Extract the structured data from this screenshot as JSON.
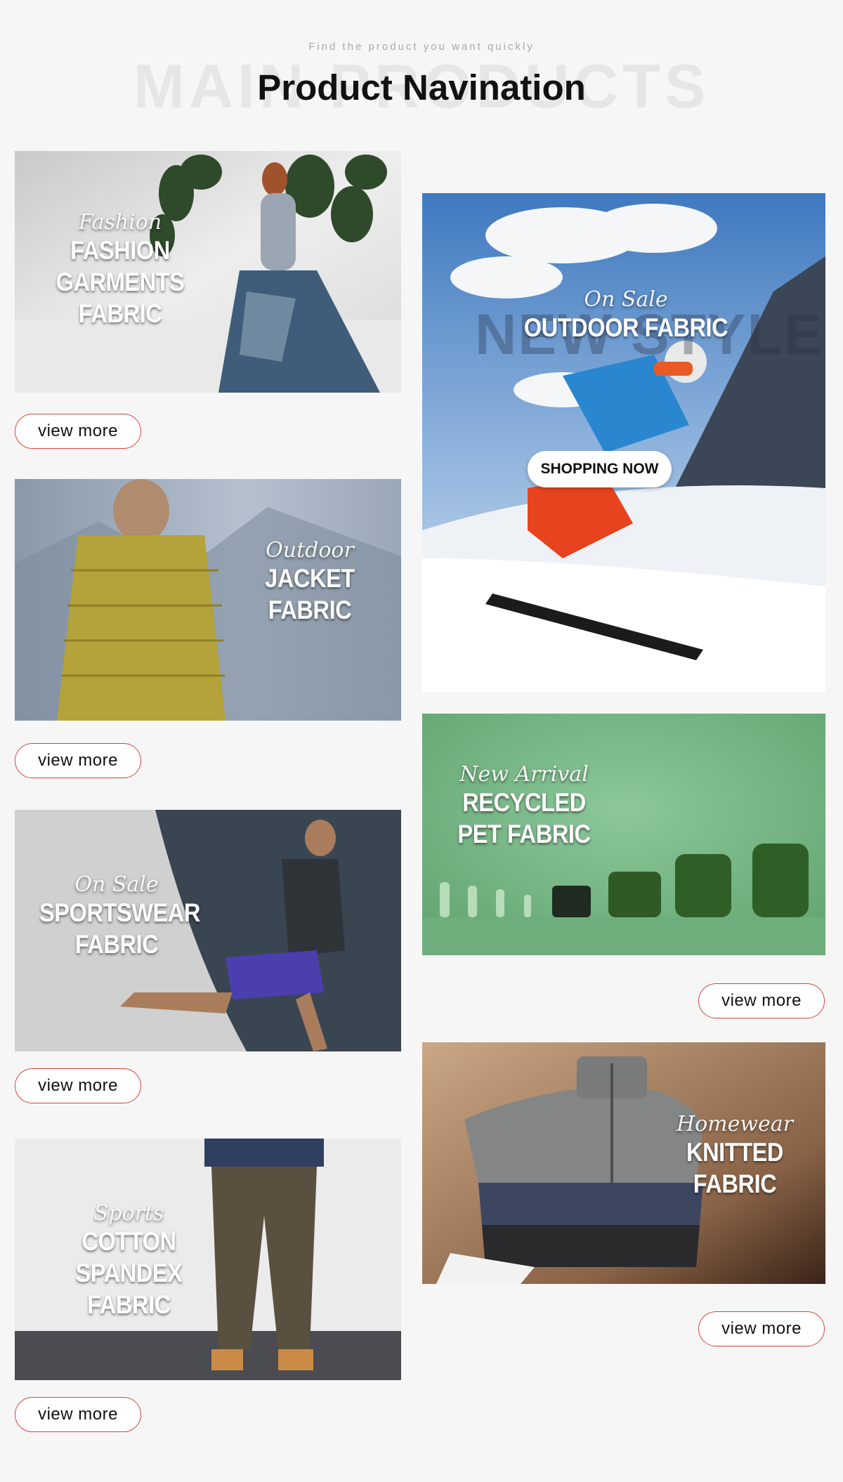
{
  "header": {
    "subtitle": "Find the product you want quickly",
    "background_word": "MAIN PRODUCTS",
    "title": "Product Navination"
  },
  "products": [
    {
      "script": "Fashion",
      "title_lines": [
        "FASHION",
        "GARMENTS",
        "FABRIC"
      ],
      "button": "view more"
    },
    {
      "script": "Outdoor",
      "title_lines": [
        "JACKET",
        "FABRIC"
      ],
      "button": "view more"
    },
    {
      "script": "On Sale",
      "title_lines": [
        "SPORTSWEAR",
        "FABRIC"
      ],
      "button": "view more"
    },
    {
      "script": "Sports",
      "title_lines": [
        "COTTON SPANDEX",
        "FABRIC"
      ],
      "button": "view more"
    },
    {
      "script": "On Sale",
      "ghost_word": "NEW STYLE",
      "title_lines": [
        "OUTDOOR FABRIC"
      ],
      "cta": "SHOPPING NOW"
    },
    {
      "script": "New Arrival",
      "title_lines": [
        "RECYCLED",
        "PET FABRIC"
      ],
      "button": "view more"
    },
    {
      "script": "Homewear",
      "title_lines": [
        "KNITTED",
        "FABRIC"
      ],
      "button": "view more"
    }
  ],
  "colors": {
    "background": "#f6f6f7",
    "button_border": "#d8453c",
    "title": "#111111"
  }
}
